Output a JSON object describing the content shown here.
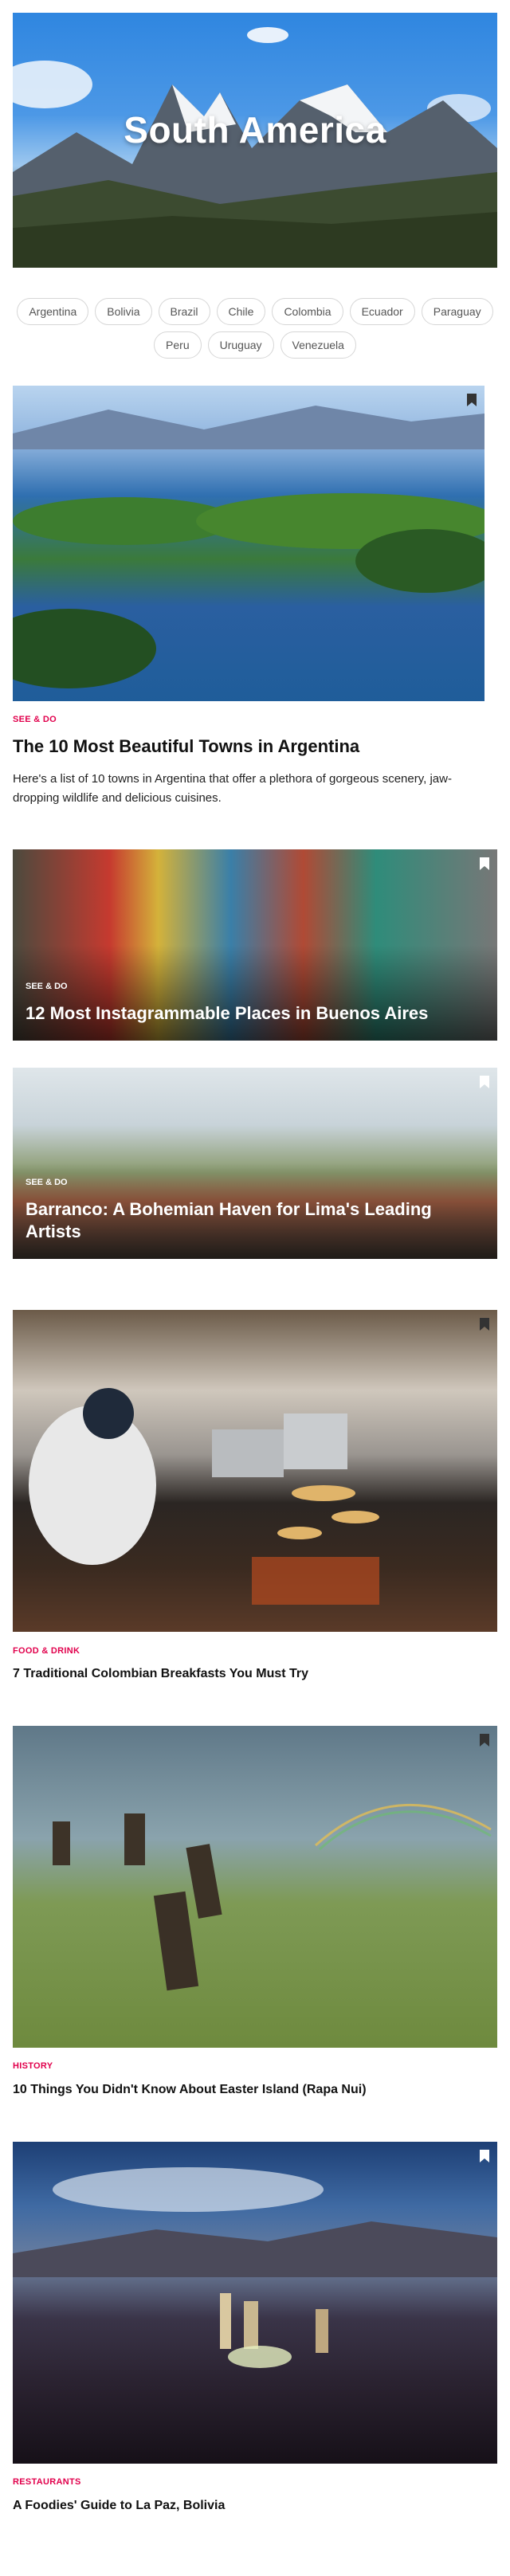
{
  "hero": {
    "title": "South America"
  },
  "countries_row1": [
    "Argentina",
    "Bolivia",
    "Brazil",
    "Chile",
    "Colombia",
    "Ecuador",
    "Paraguay"
  ],
  "countries_row2": [
    "Peru",
    "Uruguay",
    "Venezuela"
  ],
  "articles": [
    {
      "category": "SEE & DO",
      "title": "The 10 Most Beautiful Towns in Argentina",
      "description": "Here's a list of 10 towns in Argentina that offer a plethora of gorgeous scenery, jaw-dropping wildlife and delicious cuisines."
    },
    {
      "category": "SEE & DO",
      "title": "12 Most Instagrammable Places in Buenos Aires"
    },
    {
      "category": "SEE & DO",
      "title": "Barranco: A Bohemian Haven for Lima's Leading Artists"
    },
    {
      "category": "FOOD & DRINK",
      "title": "7 Traditional Colombian Breakfasts You Must Try"
    },
    {
      "category": "HISTORY",
      "title": "10 Things You Didn't Know About Easter Island (Rapa Nui)"
    },
    {
      "category": "RESTAURANTS",
      "title": "A Foodies' Guide to La Paz, Bolivia"
    }
  ],
  "colors": {
    "accent": "#e1004c",
    "chip_border": "#d6d6d6"
  }
}
